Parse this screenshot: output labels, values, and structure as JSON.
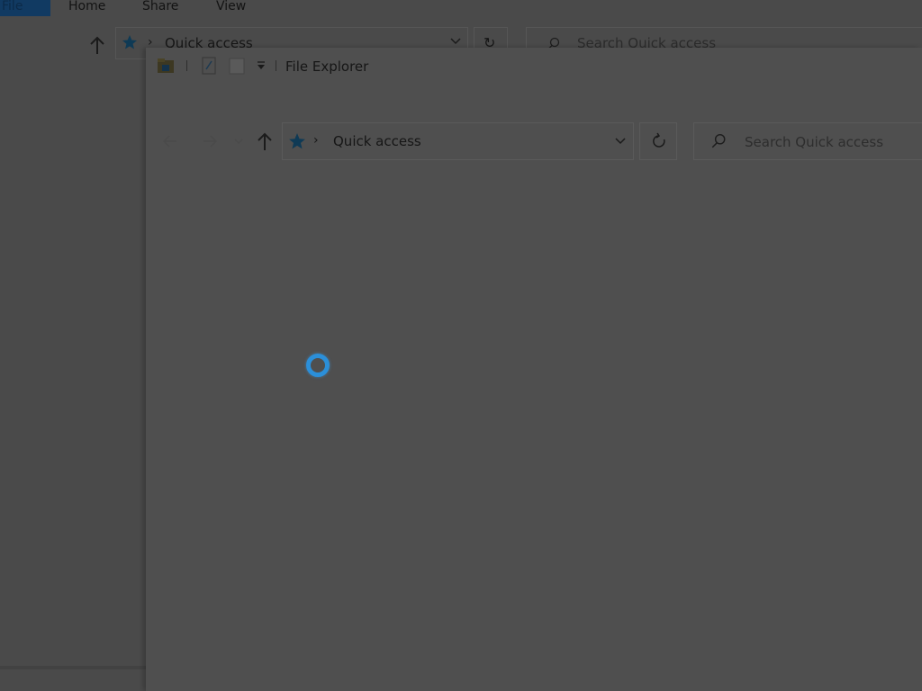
{
  "background_window": {
    "ribbon_tabs": [
      "File",
      "Home",
      "Share",
      "View"
    ],
    "address": {
      "location": "Quick access"
    },
    "search": {
      "placeholder": "Search Quick access"
    }
  },
  "window": {
    "title": "File Explorer",
    "address": {
      "location": "Quick access"
    },
    "search": {
      "placeholder": "Search Quick access"
    },
    "loading": true
  },
  "colors": {
    "accent": "#2b8fd9",
    "overlay": "#4f4f4f",
    "file_tab": "#113a62"
  },
  "icons": {
    "quick_access": "star-icon",
    "folder": "folder-icon",
    "refresh": "refresh-icon",
    "search": "search-icon",
    "up": "up-arrow-icon",
    "dropdown": "chevron-down-icon",
    "loading": "loading-spinner-icon"
  }
}
